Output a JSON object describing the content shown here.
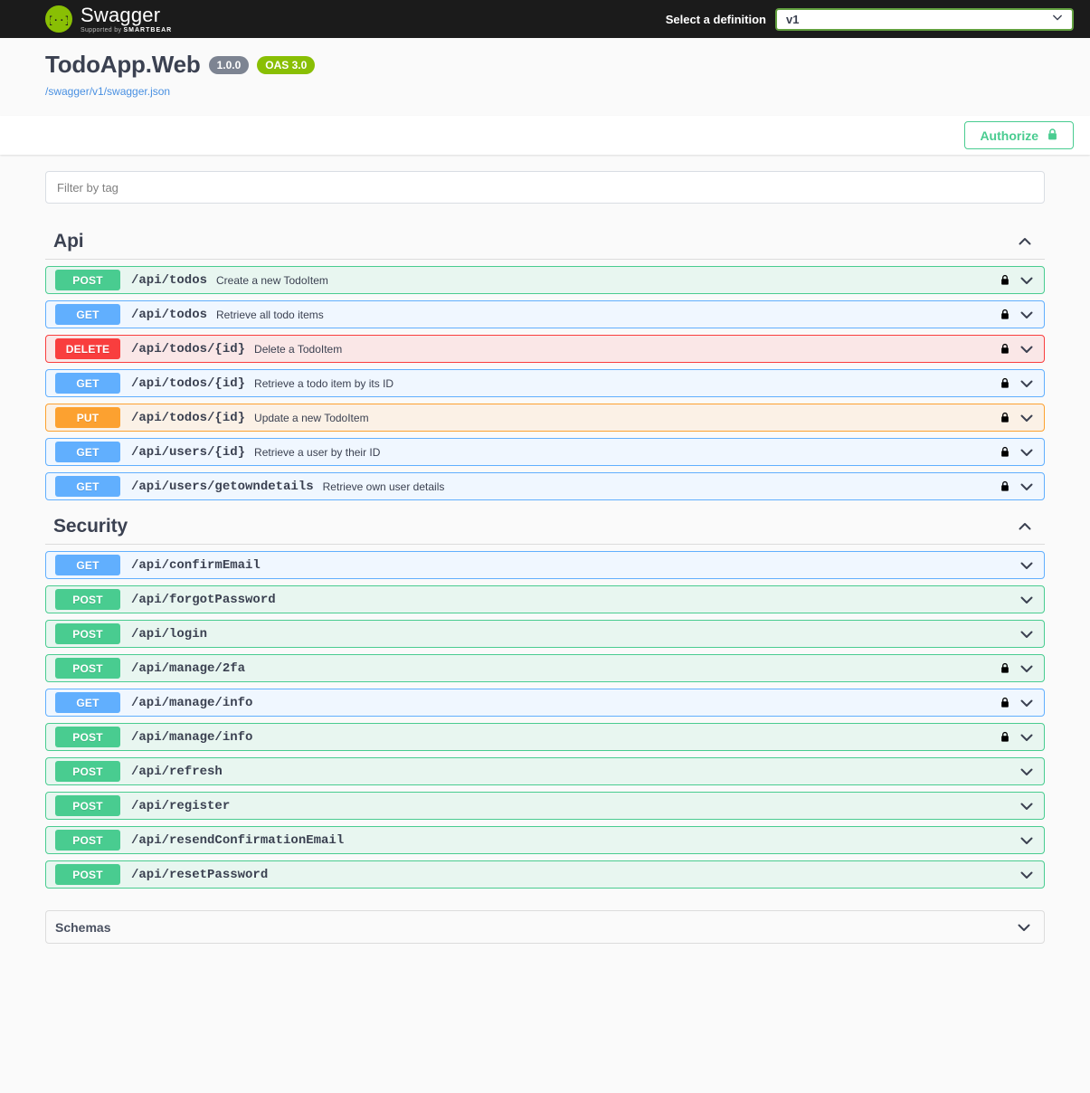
{
  "topbar": {
    "logo_name": "Swagger",
    "logo_supported_prefix": "Supported by",
    "logo_supported_brand": "SMARTBEAR",
    "definition_label": "Select a definition",
    "definition_value": "v1",
    "definition_options": [
      "v1"
    ]
  },
  "info": {
    "title": "TodoApp.Web",
    "version_badge": "1.0.0",
    "spec_badge": "OAS 3.0",
    "spec_url": "/swagger/v1/swagger.json"
  },
  "authorize": {
    "label": "Authorize",
    "icon": "lock-icon",
    "accent_color": "#49cc90"
  },
  "filter": {
    "placeholder": "Filter by tag",
    "value": ""
  },
  "colors": {
    "get": "#61affe",
    "post": "#49cc90",
    "put": "#fca130",
    "delete": "#f93e3e",
    "brand_green": "#89bf04",
    "topbar_bg": "#1b1b1b",
    "page_bg": "#fafafa"
  },
  "sections": [
    {
      "name": "Api",
      "expanded": true,
      "toggle_icon": "chevron-up-icon",
      "operations": [
        {
          "method": "POST",
          "path": "/api/todos",
          "summary": "Create a new TodoItem",
          "locked": true
        },
        {
          "method": "GET",
          "path": "/api/todos",
          "summary": "Retrieve all todo items",
          "locked": true
        },
        {
          "method": "DELETE",
          "path": "/api/todos/{id}",
          "summary": "Delete a TodoItem",
          "locked": true
        },
        {
          "method": "GET",
          "path": "/api/todos/{id}",
          "summary": "Retrieve a todo item by its ID",
          "locked": true
        },
        {
          "method": "PUT",
          "path": "/api/todos/{id}",
          "summary": "Update a new TodoItem",
          "locked": true
        },
        {
          "method": "GET",
          "path": "/api/users/{id}",
          "summary": "Retrieve a user by their ID",
          "locked": true
        },
        {
          "method": "GET",
          "path": "/api/users/getowndetails",
          "summary": "Retrieve own user details",
          "locked": true
        }
      ]
    },
    {
      "name": "Security",
      "expanded": true,
      "toggle_icon": "chevron-up-icon",
      "operations": [
        {
          "method": "GET",
          "path": "/api/confirmEmail",
          "summary": "",
          "locked": false
        },
        {
          "method": "POST",
          "path": "/api/forgotPassword",
          "summary": "",
          "locked": false
        },
        {
          "method": "POST",
          "path": "/api/login",
          "summary": "",
          "locked": false
        },
        {
          "method": "POST",
          "path": "/api/manage/2fa",
          "summary": "",
          "locked": true
        },
        {
          "method": "GET",
          "path": "/api/manage/info",
          "summary": "",
          "locked": true
        },
        {
          "method": "POST",
          "path": "/api/manage/info",
          "summary": "",
          "locked": true
        },
        {
          "method": "POST",
          "path": "/api/refresh",
          "summary": "",
          "locked": false
        },
        {
          "method": "POST",
          "path": "/api/register",
          "summary": "",
          "locked": false
        },
        {
          "method": "POST",
          "path": "/api/resendConfirmationEmail",
          "summary": "",
          "locked": false
        },
        {
          "method": "POST",
          "path": "/api/resetPassword",
          "summary": "",
          "locked": false
        }
      ]
    }
  ],
  "schemas": {
    "title": "Schemas",
    "expanded": false,
    "toggle_icon": "chevron-down-icon"
  }
}
